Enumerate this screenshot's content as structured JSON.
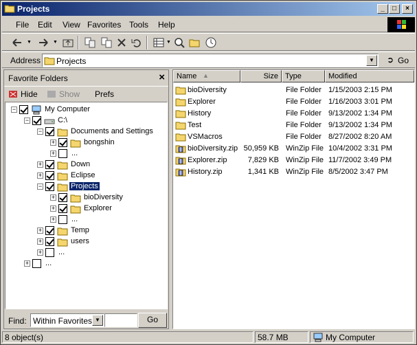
{
  "window": {
    "title": "Projects"
  },
  "menu": [
    "File",
    "Edit",
    "View",
    "Favorites",
    "Tools",
    "Help"
  ],
  "address": {
    "label": "Address",
    "value": "Projects",
    "go": "Go"
  },
  "left_pane": {
    "title": "Favorite Folders",
    "tools": {
      "hide": "Hide",
      "show": "Show",
      "prefs": "Prefs"
    },
    "tree": [
      {
        "label": "My Computer",
        "level": 0,
        "checked": true,
        "icon": "computer-icon"
      },
      {
        "label": "C:\\",
        "level": 1,
        "checked": true,
        "icon": "drive-icon"
      },
      {
        "label": "Documents and Settings",
        "level": 2,
        "checked": true,
        "icon": "folder-icon"
      },
      {
        "label": "bongshin",
        "level": 3,
        "checked": true,
        "icon": "folder-icon"
      },
      {
        "label": "...",
        "level": 3,
        "checked": false,
        "icon": ""
      },
      {
        "label": "Down",
        "level": 2,
        "checked": true,
        "icon": "folder-icon"
      },
      {
        "label": "Eclipse",
        "level": 2,
        "checked": true,
        "icon": "folder-icon"
      },
      {
        "label": "Projects",
        "level": 2,
        "checked": true,
        "icon": "folder-icon",
        "selected": true
      },
      {
        "label": "bioDiversity",
        "level": 3,
        "checked": true,
        "icon": "folder-icon"
      },
      {
        "label": "Explorer",
        "level": 3,
        "checked": true,
        "icon": "folder-icon"
      },
      {
        "label": "...",
        "level": 3,
        "checked": false,
        "icon": ""
      },
      {
        "label": "Temp",
        "level": 2,
        "checked": true,
        "icon": "folder-icon"
      },
      {
        "label": "users",
        "level": 2,
        "checked": true,
        "icon": "folder-icon"
      },
      {
        "label": "...",
        "level": 2,
        "checked": false,
        "icon": ""
      },
      {
        "label": "...",
        "level": 1,
        "checked": false,
        "icon": ""
      }
    ],
    "find": {
      "label": "Find:",
      "option": "Within Favorites",
      "input": "",
      "go": "Go"
    }
  },
  "columns": {
    "name": "Name",
    "size": "Size",
    "type": "Type",
    "modified": "Modified"
  },
  "files": [
    {
      "name": "bioDiversity",
      "size": "",
      "type": "File Folder",
      "modified": "1/15/2003 2:15 PM",
      "icon": "folder-icon"
    },
    {
      "name": "Explorer",
      "size": "",
      "type": "File Folder",
      "modified": "1/16/2003 3:01 PM",
      "icon": "folder-icon"
    },
    {
      "name": "History",
      "size": "",
      "type": "File Folder",
      "modified": "9/13/2002 1:34 PM",
      "icon": "folder-icon"
    },
    {
      "name": "Test",
      "size": "",
      "type": "File Folder",
      "modified": "9/13/2002 1:34 PM",
      "icon": "folder-icon"
    },
    {
      "name": "VSMacros",
      "size": "",
      "type": "File Folder",
      "modified": "8/27/2002 8:20 AM",
      "icon": "folder-icon"
    },
    {
      "name": "bioDiversity.zip",
      "size": "50,959 KB",
      "type": "WinZip File",
      "modified": "10/4/2002 3:31 PM",
      "icon": "zip-icon"
    },
    {
      "name": "Explorer.zip",
      "size": "7,829 KB",
      "type": "WinZip File",
      "modified": "11/7/2002 3:49 PM",
      "icon": "zip-icon"
    },
    {
      "name": "History.zip",
      "size": "1,341 KB",
      "type": "WinZip File",
      "modified": "8/5/2002 3:47 PM",
      "icon": "zip-icon"
    }
  ],
  "status": {
    "objects": "8 object(s)",
    "size": "58.7 MB",
    "zone": "My Computer"
  }
}
